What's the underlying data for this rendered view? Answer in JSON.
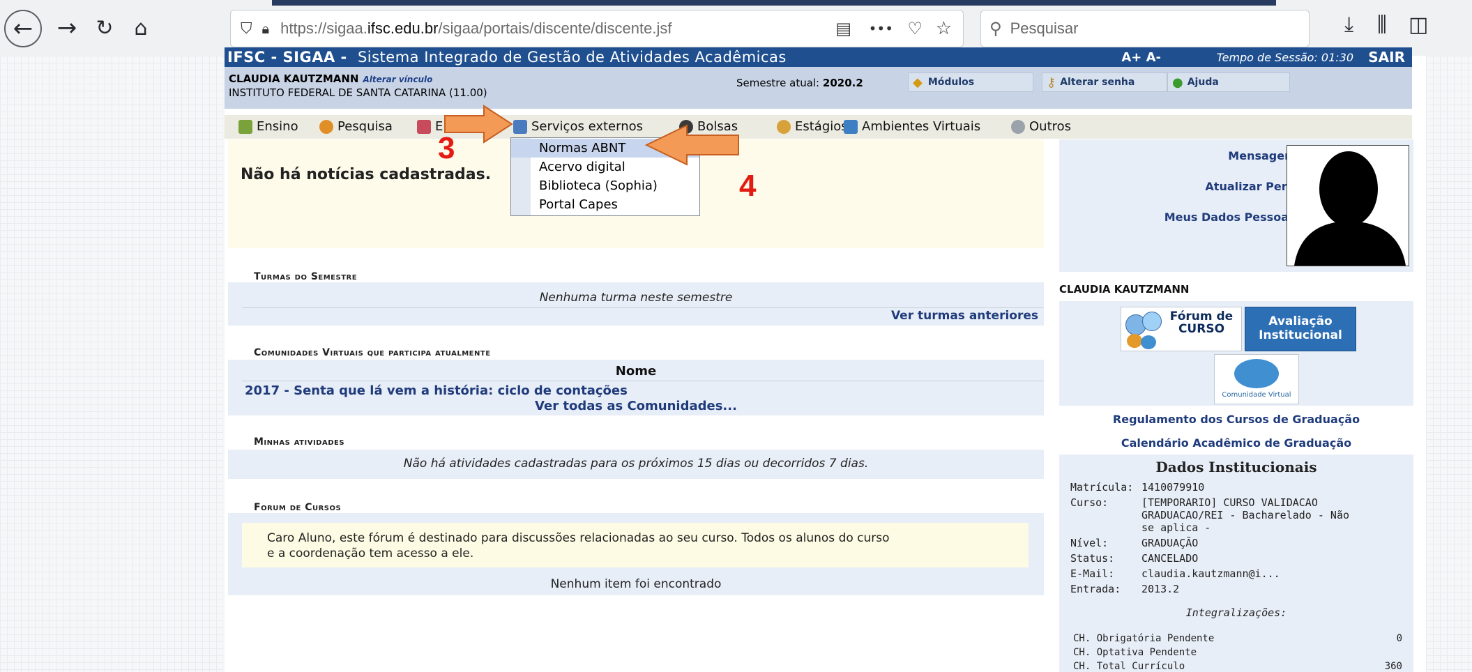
{
  "browser": {
    "url_prefix": "https://sigaa.",
    "url_domain": "ifsc.edu.br",
    "url_path": "/sigaa/portais/discente/discente.jsf",
    "search_placeholder": "Pesquisar",
    "menu_dots": "•••"
  },
  "header": {
    "brand": "IFSC - SIGAA -",
    "system_name": "Sistema Integrado de Gestão de Atividades Acadêmicas",
    "font_controls": "A+ A-",
    "session_label": "Tempo de Sessão: 01:30",
    "logout": "SAIR",
    "user_name": "CLAUDIA KAUTZMANN",
    "change_link": "Alterar vínculo",
    "institution": "INSTITUTO FEDERAL DE SANTA CATARINA (11.00)",
    "semester_label": "Semestre atual:",
    "semester_value": "2020.2",
    "modules": "Módulos",
    "change_password": "Alterar senha",
    "help": "Ajuda"
  },
  "menu": {
    "items": [
      "Ensino",
      "Pesquisa",
      "E",
      "Serviços externos",
      "Bolsas",
      "Estágios",
      "Ambientes Virtuais",
      "Outros"
    ],
    "dropdown": [
      "Normas ABNT",
      "Acervo digital",
      "Biblioteca (Sophia)",
      "Portal Capes"
    ]
  },
  "annotations": {
    "step3": "3",
    "step4": "4"
  },
  "news": {
    "empty": "Não há notícias cadastradas."
  },
  "turmas": {
    "title": "Turmas do Semestre",
    "empty": "Nenhuma turma neste semestre",
    "link": "Ver turmas anteriores"
  },
  "comunidades": {
    "title": "Comunidades Virtuais que participa atualmente",
    "col": "Nome",
    "item": "2017 - Senta que lá vem a história: ciclo de contações",
    "link": "Ver todas as Comunidades..."
  },
  "atividades": {
    "title": "Minhas atividades",
    "empty": "Não há atividades cadastradas para os próximos 15 dias ou decorridos 7 dias."
  },
  "forum": {
    "title": "Forum de Cursos",
    "desc_line1": "Caro Aluno, este fórum é destinado para discussões relacionadas ao seu curso. Todos os alunos do curso",
    "desc_line2": "e a coordenação tem acesso a ele.",
    "empty": "Nenhum item foi encontrado"
  },
  "profile": {
    "messages": "Mensagens",
    "update": "Atualizar Perfil",
    "personal": "Meus Dados Pessoais",
    "name": "CLAUDIA KAUTZMANN",
    "forum_badge": "Fórum de CURSO",
    "eval_badge_l1": "Avaliação",
    "eval_badge_l2": "Institucional",
    "community_badge": "Comunidade Virtual",
    "reg_link": "Regulamento dos Cursos de Graduação",
    "cal_link": "Calendário Acadêmico de Graduação"
  },
  "institutional": {
    "title": "Dados Institucionais",
    "rows": [
      {
        "label": "Matrícula:",
        "value": "1410079910"
      },
      {
        "label": "Curso:",
        "value": "[TEMPORARIO] CURSO VALIDACAO"
      },
      {
        "label": "",
        "value": "GRADUACAO/REI - Bacharelado - Não"
      },
      {
        "label": "",
        "value": "se aplica -"
      },
      {
        "label": "Nível:",
        "value": "GRADUAÇÃO"
      },
      {
        "label": "Status:",
        "value": "CANCELADO"
      },
      {
        "label": "E-Mail:",
        "value": "claudia.kautzmann@i..."
      },
      {
        "label": "Entrada:",
        "value": "2013.2"
      }
    ],
    "integ_title": "Integralizações:",
    "integ": [
      {
        "label": "CH. Obrigatória Pendente",
        "value": "0"
      },
      {
        "label": "CH. Optativa Pendente",
        "value": ""
      },
      {
        "label": "CH. Total Currículo",
        "value": "360"
      }
    ]
  }
}
